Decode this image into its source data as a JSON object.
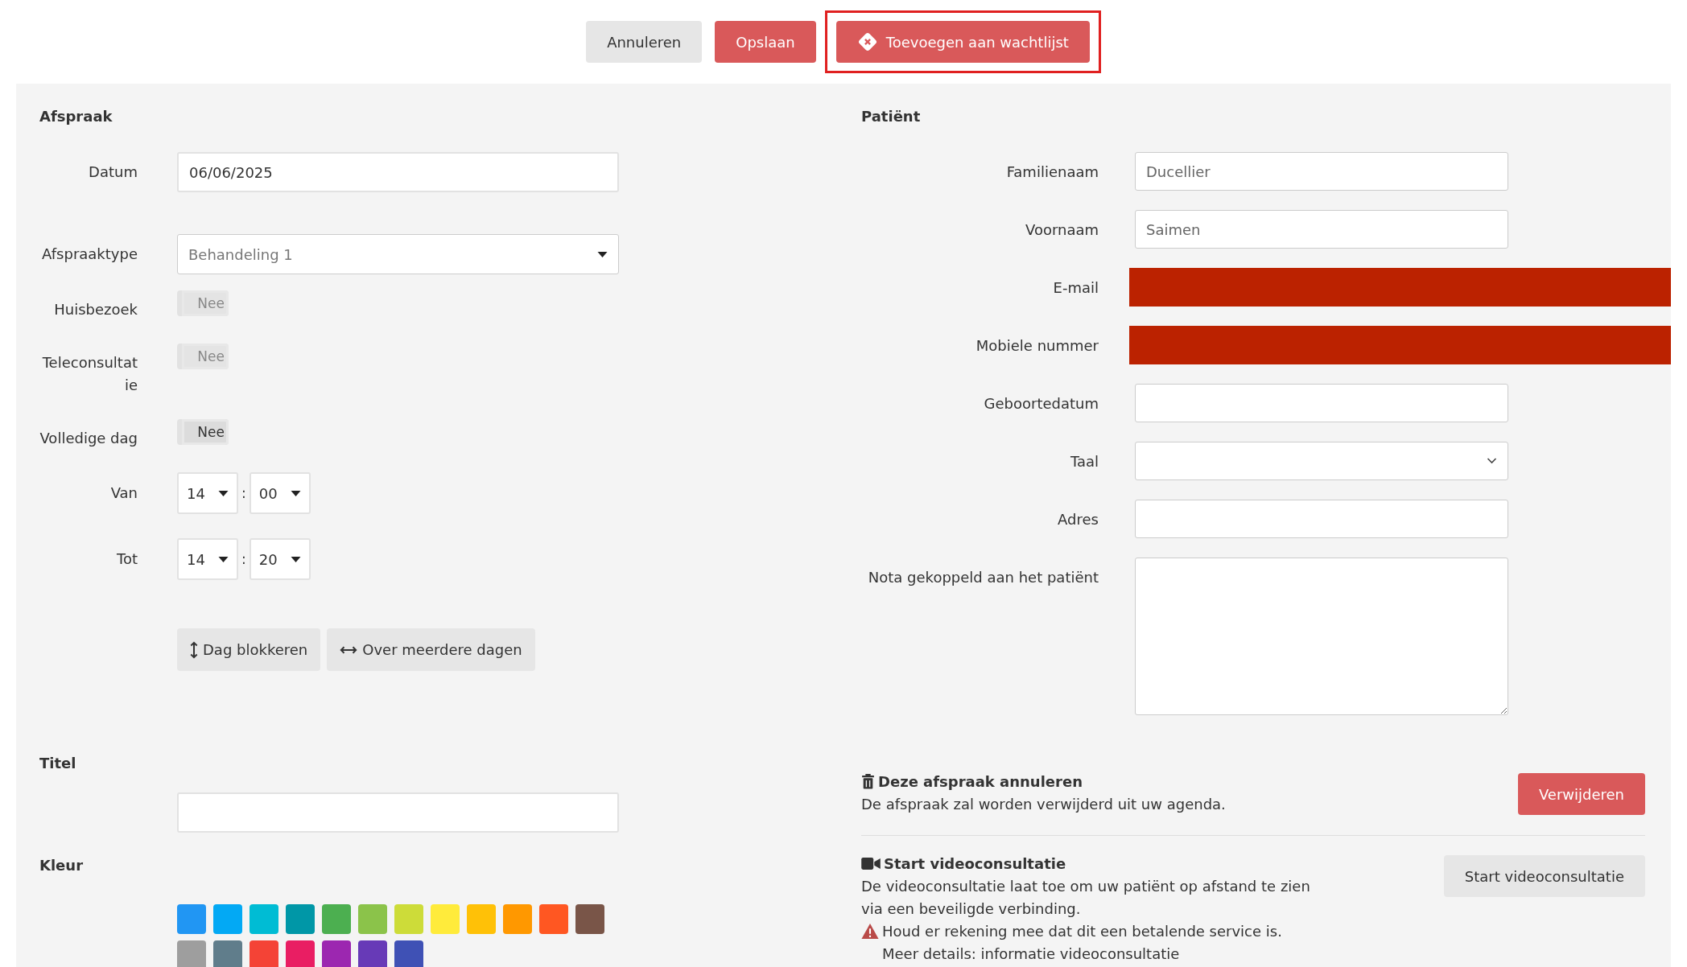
{
  "top_buttons": [
    {
      "label": "Annuleren",
      "kind": "secondary",
      "highlighted": false
    },
    {
      "label": "Opslaan",
      "kind": "primary",
      "highlighted": false
    },
    {
      "label": "Toevoegen aan wachtlijst",
      "kind": "primary",
      "highlighted": true
    }
  ],
  "appointment": {
    "heading": "Afspraak",
    "fields": [
      {
        "kind": "text",
        "label": "Datum",
        "value": "06/06/2025"
      },
      {
        "kind": "select",
        "label": "Afspraaktype",
        "value": "Behandeling 1"
      },
      {
        "kind": "toggle",
        "label": "Huisbezoek",
        "text": "Nee",
        "on": false,
        "disabled": true
      },
      {
        "kind": "toggle",
        "label": "Teleconsultatie",
        "text": "Nee",
        "on": false,
        "disabled": true
      },
      {
        "kind": "toggle",
        "label": "Volledige dag",
        "text": "Nee",
        "on": false,
        "disabled": false
      },
      {
        "kind": "time",
        "label": "Van",
        "hour": "14",
        "separator": ":",
        "minute": "00"
      },
      {
        "kind": "time",
        "label": "Tot",
        "hour": "14",
        "separator": ":",
        "minute": "20"
      }
    ],
    "actions": [
      {
        "label": "Dag blokkeren"
      },
      {
        "label": "Over meerdere dagen"
      }
    ],
    "title_heading": "Titel",
    "color_heading": "Kleur",
    "colors": [
      {
        "color": "#2196f3"
      },
      {
        "color": "#03a9f4"
      },
      {
        "color": "#00bcd4"
      },
      {
        "color": "#0097a7"
      },
      {
        "color": "#4caf50"
      },
      {
        "color": "#8bc34a"
      },
      {
        "color": "#cddc39"
      },
      {
        "color": "#ffeb3b"
      },
      {
        "color": "#ffc107"
      },
      {
        "color": "#ff9800"
      },
      {
        "color": "#ff5722"
      },
      {
        "color": "#795548"
      },
      {
        "color": "#9e9e9e"
      },
      {
        "color": "#607d8b"
      },
      {
        "color": "#f44336"
      },
      {
        "color": "#e91e63"
      },
      {
        "color": "#9c27b0"
      },
      {
        "color": "#673ab7"
      },
      {
        "color": "#3f51b5"
      }
    ]
  },
  "patient": {
    "heading": "Patiënt",
    "fields": [
      {
        "kind": "text",
        "label": "Familienaam",
        "value": "Ducellier",
        "redacted": false
      },
      {
        "kind": "text",
        "label": "Voornaam",
        "value": "Saimen",
        "redacted": false
      },
      {
        "kind": "text",
        "label": "E-mail",
        "redacted": true
      },
      {
        "kind": "text",
        "label": "Mobiele nummer",
        "redacted": true
      },
      {
        "kind": "text",
        "label": "Geboortedatum",
        "redacted": false
      },
      {
        "kind": "select",
        "label": "Taal",
        "redacted": false
      },
      {
        "kind": "text",
        "label": "Adres",
        "redacted": false
      },
      {
        "kind": "textarea",
        "label": "Nota gekoppeld aan het patiënt",
        "redacted": false
      }
    ]
  },
  "actions": [
    {
      "title": "Deze afspraak annuleren",
      "lines": [
        "De afspraak zal worden verwijderd uit uw agenda."
      ],
      "button": {
        "label": "Verwijderen",
        "kind": "danger"
      }
    },
    {
      "title": "Start videoconsultatie",
      "lines": [
        "De videoconsultatie laat toe om uw patiënt op afstand te zien via een beveiligde verbinding."
      ],
      "warning": "Houd er rekening mee dat dit een betalende service is. Meer details: informatie videoconsultatie",
      "button": {
        "label": "Start videoconsultatie",
        "kind": "secondary"
      }
    }
  ]
}
